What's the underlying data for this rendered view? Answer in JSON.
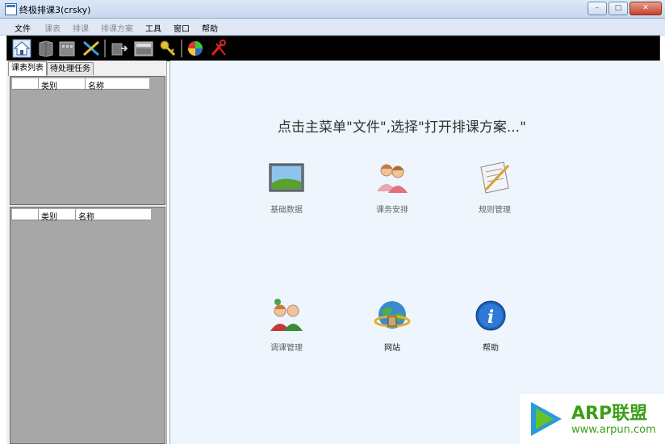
{
  "window": {
    "title": "终极排课3(crsky)",
    "buttons": {
      "minimize": "–",
      "maximize": "□",
      "close": "✕"
    }
  },
  "menu": [
    {
      "label": "文件",
      "enabled": true
    },
    {
      "label": "课表",
      "enabled": false
    },
    {
      "label": "排课",
      "enabled": false
    },
    {
      "label": "排课方案",
      "enabled": false
    },
    {
      "label": "工具",
      "enabled": true
    },
    {
      "label": "窗口",
      "enabled": true
    },
    {
      "label": "帮助",
      "enabled": true
    }
  ],
  "toolbar": {
    "icons": [
      "home-icon",
      "book-icon",
      "schedule-icon",
      "cross-arrows-icon",
      "export-icon",
      "calculator-icon",
      "keys-icon",
      "globe-icon",
      "tools-icon"
    ]
  },
  "left_panel": {
    "tabs": [
      {
        "label": "课表列表",
        "active": true
      },
      {
        "label": "待处理任务",
        "active": false
      }
    ],
    "grid_top": {
      "columns": [
        "类别",
        "名称"
      ]
    },
    "grid_bottom": {
      "columns": [
        "类别",
        "名称"
      ]
    }
  },
  "main": {
    "hint": "点击主菜单\"文件\",选择\"打开排课方案...\"",
    "features": [
      {
        "label": "基础数据",
        "icon": "landscape-picture-icon",
        "enabled": false
      },
      {
        "label": "课务安排",
        "icon": "people-icon",
        "enabled": false
      },
      {
        "label": "规则管理",
        "icon": "notepad-pencil-icon",
        "enabled": false
      },
      {
        "label": "调课管理",
        "icon": "couple-swap-icon",
        "enabled": false
      },
      {
        "label": "网站",
        "icon": "globe-icon",
        "enabled": true
      },
      {
        "label": "帮助",
        "icon": "info-icon",
        "enabled": true
      }
    ]
  },
  "watermark": {
    "brand": "ARP联盟",
    "url": "www.arpun.com"
  },
  "colors": {
    "toolbar_bg": "#000000",
    "main_bg": "#eef5fc",
    "grid_bg": "#a7a7a7",
    "logo_green": "#3a9f16"
  }
}
